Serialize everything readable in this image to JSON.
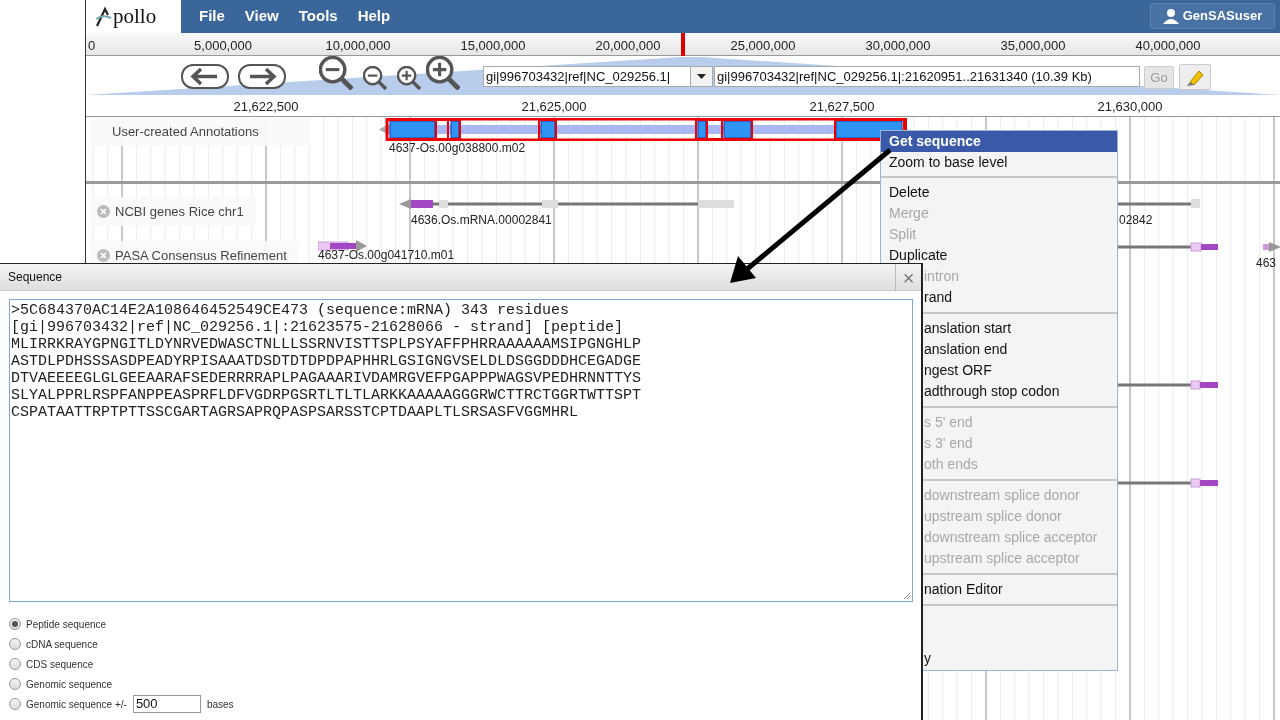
{
  "logo": "pollo",
  "menu": [
    "File",
    "View",
    "Tools",
    "Help"
  ],
  "user": "GenSASuser",
  "overview_ruler": [
    "0",
    "5,000,000",
    "10,000,000",
    "15,000,000",
    "20,000,000",
    "25,000,000",
    "30,000,000",
    "35,000,000",
    "40,000,000"
  ],
  "toolbar": {
    "sequence_select": "gi|996703432|ref|NC_029256.1|",
    "location": "gi|996703432|ref|NC_029256.1|:21620951..21631340 (10.39 Kb)",
    "go": "Go",
    "go_disabled": true
  },
  "detail_ruler": [
    "21,622,500",
    "21,625,000",
    "21,627,500",
    "21,630,000"
  ],
  "tracks": [
    {
      "label": "User-created Annotations",
      "closable": false,
      "features": [
        {
          "kind": "model",
          "label": "4637-Os.00g038800.m02"
        }
      ]
    },
    {
      "label": "NCBI genes Rice chr1",
      "closable": true,
      "features": [
        {
          "kind": "gene",
          "label": "4636.Os.mRNA.00002841"
        },
        {
          "kind": "gene-end",
          "label": "02842"
        }
      ]
    },
    {
      "label": "PASA Consensus Refinement",
      "closable": true,
      "features": [
        {
          "kind": "transcript",
          "label": "4637-Os.00g041710.m01"
        },
        {
          "kind": "transcript-start",
          "label": "463"
        }
      ]
    }
  ],
  "context_menu": [
    [
      {
        "label": "Get sequence",
        "selected": true,
        "disabled": false,
        "partial": false
      },
      {
        "label": "Zoom to base level",
        "selected": false,
        "disabled": false,
        "partial": false
      }
    ],
    [
      {
        "label": "Delete",
        "selected": false,
        "disabled": false,
        "partial": false
      },
      {
        "label": "Merge",
        "selected": false,
        "disabled": true,
        "partial": false
      },
      {
        "label": "Split",
        "selected": false,
        "disabled": true,
        "partial": false
      },
      {
        "label": "Duplicate",
        "selected": false,
        "disabled": false,
        "partial": false
      },
      {
        "label": "intron",
        "selected": false,
        "disabled": true,
        "partial": true
      },
      {
        "label": "rand",
        "selected": false,
        "disabled": false,
        "partial": true
      }
    ],
    [
      {
        "label": "anslation start",
        "selected": false,
        "disabled": false,
        "partial": true
      },
      {
        "label": "anslation end",
        "selected": false,
        "disabled": false,
        "partial": true
      },
      {
        "label": "ngest ORF",
        "selected": false,
        "disabled": false,
        "partial": true
      },
      {
        "label": "adthrough stop codon",
        "selected": false,
        "disabled": false,
        "partial": true
      }
    ],
    [
      {
        "label": "s 5' end",
        "selected": false,
        "disabled": true,
        "partial": true
      },
      {
        "label": "s 3' end",
        "selected": false,
        "disabled": true,
        "partial": true
      },
      {
        "label": "oth ends",
        "selected": false,
        "disabled": true,
        "partial": true
      }
    ],
    [
      {
        "label": "downstream splice donor",
        "selected": false,
        "disabled": true,
        "partial": true
      },
      {
        "label": "upstream splice donor",
        "selected": false,
        "disabled": true,
        "partial": true
      },
      {
        "label": "downstream splice acceptor",
        "selected": false,
        "disabled": true,
        "partial": true
      },
      {
        "label": "upstream splice acceptor",
        "selected": false,
        "disabled": true,
        "partial": true
      }
    ],
    [
      {
        "label": "nation Editor",
        "selected": false,
        "disabled": false,
        "partial": true
      }
    ],
    [
      {
        "label": "y",
        "selected": false,
        "disabled": false,
        "partial": true
      }
    ]
  ],
  "dialog": {
    "title": "Sequence",
    "close": "×",
    "sequence": ">5C684370AC14E2A108646452549CE473 (sequence:mRNA) 343 residues\n[gi|996703432|ref|NC_029256.1|:21623575-21628066 - strand] [peptide]\nMLIRRKRAYGPNGITLDYNRVEDWASCTNLLLSSRNVISTTSPLPSYAFFPHRRAAAAAAMSIPGNGHLP\nASTDLPDHSSSASDPEADYRPISAAATDSDTDTDPDPAPHHRLGSIGNGVSELDLDSGGDDDHCEGADGE\nDTVAEEEEGLGLGEEAARAFSEDERRRRAPLPAGAAARIVDAMRGVEFPGAPPPWAGSVPEDHRNNTTYS\nSLYALPPRLRSPFANPPEASPRFLDFVGDRPGSRTLTLTLARKKAAAAAGGGRWCTTRCTGGRTWTTSPT\nCSPATAATTRPTPTTSSCGARTAGRSAPRQPASPSARSSTCPTDAAPLTLSRSASFVGGMHRL",
    "options": [
      {
        "label": "Peptide sequence",
        "selected": true
      },
      {
        "label": "cDNA sequence",
        "selected": false
      },
      {
        "label": "CDS sequence",
        "selected": false
      },
      {
        "label": "Genomic sequence",
        "selected": false
      },
      {
        "label": "Genomic sequence +/-",
        "selected": false,
        "flank": "500",
        "unit": "bases"
      }
    ]
  }
}
